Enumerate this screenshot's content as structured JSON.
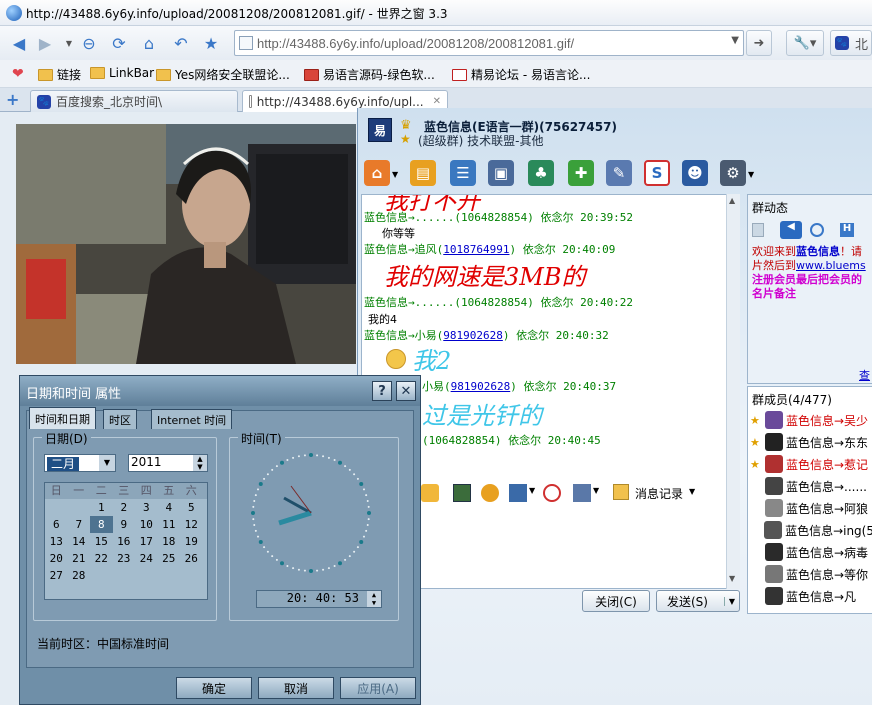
{
  "browser": {
    "title": "http://43488.6y6y.info/upload/20081208/200812081.gif/ - 世界之窗 3.3",
    "address": "http://43488.6y6y.info/upload/20081208/200812081.gif/",
    "bookmarks": [
      "链接",
      "LinkBar",
      "Yes网络安全联盟论...",
      "易语言源码-绿色软...",
      "精易论坛 - 易语言论..."
    ],
    "tabs": [
      "百度搜索_北京时间\\",
      "http://43488.6y6y.info/upl..."
    ],
    "search_engine_label": "北"
  },
  "qq": {
    "logo_text": "易",
    "group_name": "蓝色信息(E语言一群)(75627457)",
    "group_sub": "(超级群) 技术联盟-其他",
    "messages": {
      "partial_top": "我打不开",
      "m1_head": "蓝色信息→......(1064828854)  依念尔 20:39:52",
      "m1_body": "你等等",
      "m2_head_a": "蓝色信息→追风(",
      "m2_id": "1018764991",
      "m2_head_b": ")  依念尔 20:40:09",
      "m2_body": "我的网速是3MB的",
      "m3_head": "蓝色信息→......(1064828854)  依念尔 20:40:22",
      "m3_body": "我的4",
      "m4_head_a": "蓝色信息→小易(",
      "m4_id": "981902628",
      "m4_head_b": ")  依念尔 20:40:32",
      "m4_body": "我2",
      "m5_head_a": "小易(",
      "m5_id": "981902628",
      "m5_head_b": ")  依念尔 20:40:37",
      "m5_body": "过是光钎的",
      "m6_head": "(1064828854)  依念尔 20:40:45"
    },
    "msg_record_label": "消息记录",
    "close_label": "关闭(C)",
    "send_label": "发送(S)",
    "group_news_title": "群动态",
    "news_line1": "欢迎来到",
    "news_link1": "蓝色信息",
    "news_line1b": "！请",
    "news_line2": "片然后到",
    "news_url": "www.bluems",
    "news_line3": "注册会员最后把会员的",
    "news_line4": "名片备注",
    "news_more": "查",
    "members_title": "群成员(4/477)",
    "members": [
      {
        "name": "蓝色信息→吴少",
        "color": "#d00000"
      },
      {
        "name": "蓝色信息→东东",
        "color": "#000000"
      },
      {
        "name": "蓝色信息→惹记",
        "color": "#d00000"
      },
      {
        "name": "蓝色信息→......",
        "color": "#000000"
      },
      {
        "name": "蓝色信息→阿狼",
        "color": "#000000"
      },
      {
        "name": "蓝色信息→ing(5",
        "color": "#000000"
      },
      {
        "name": "蓝色信息→病毒",
        "color": "#000000"
      },
      {
        "name": "蓝色信息→等你",
        "color": "#000000"
      },
      {
        "name": "蓝色信息→凡",
        "color": "#000000"
      }
    ]
  },
  "dialog": {
    "title": "日期和时间 属性",
    "help_label": "?",
    "close_label": "✕",
    "tabs": [
      "时间和日期",
      "时区",
      "Internet 时间"
    ],
    "date_group": "日期(D)",
    "time_group": "时间(T)",
    "month": "二月",
    "year": "2011",
    "weekdays": [
      "日",
      "一",
      "二",
      "三",
      "四",
      "五",
      "六"
    ],
    "calendar_rows": [
      [
        "",
        "",
        "1",
        "2",
        "3",
        "4",
        "5"
      ],
      [
        "6",
        "7",
        "8",
        "9",
        "10",
        "11",
        "12"
      ],
      [
        "13",
        "14",
        "15",
        "16",
        "17",
        "18",
        "19"
      ],
      [
        "20",
        "21",
        "22",
        "23",
        "24",
        "25",
        "26"
      ],
      [
        "27",
        "28",
        "",
        "",
        "",
        "",
        ""
      ]
    ],
    "selected_day": "8",
    "time_value": "20: 40: 53",
    "timezone_label": "当前时区：",
    "timezone_value": "中国标准时间",
    "ok_label": "确定",
    "cancel_label": "取消",
    "apply_label": "应用(A)"
  }
}
